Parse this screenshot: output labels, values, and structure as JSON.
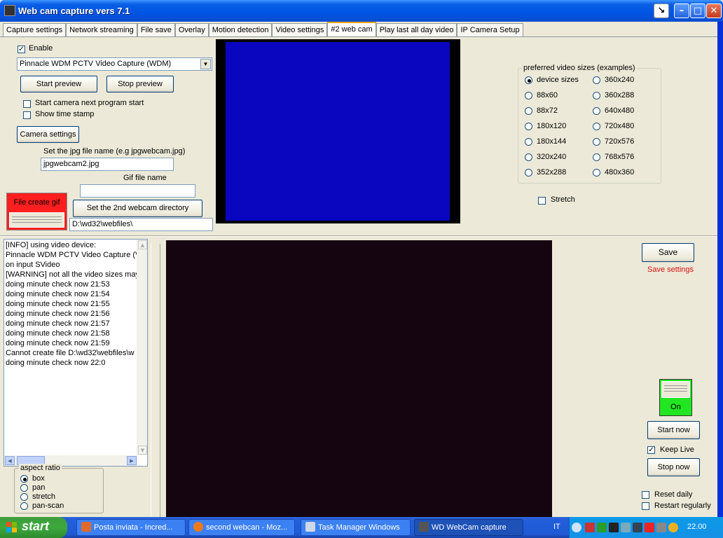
{
  "window": {
    "title": "Web cam capture vers 7.1"
  },
  "tabs": [
    "Capture settings",
    "Network streaming",
    "File save",
    "Overlay",
    "Motion detection",
    "Video settings",
    "#2 web cam",
    "Play last all day video",
    "IP Camera Setup"
  ],
  "active_tab": "#2 web cam",
  "left": {
    "enable_label": "Enable",
    "enable_checked": true,
    "device_select": "Pinnacle WDM PCTV Video Capture (WDM)",
    "start_preview": "Start preview",
    "stop_preview": "Stop preview",
    "start_next_label": "Start camera next program start",
    "show_timestamp_label": "Show time stamp",
    "camera_settings": "Camera settings",
    "jpg_label": "Set the jpg file name (e.g jpgwebcam.jpg)",
    "jpg_value": "jpgwebcam2.jpg",
    "gif_label": "Gif file name",
    "gif_value": "",
    "file_create_gif": "File create gif",
    "set_dir_button": "Set the 2nd webcam directory",
    "dir_value": "D:\\wd32\\webfiles\\"
  },
  "sizes": {
    "title": "preferred video sizes (examples)",
    "col1": [
      "device sizes",
      "88x60",
      "88x72",
      "180x120",
      "180x144",
      "320x240",
      "352x288"
    ],
    "col2": [
      "360x240",
      "360x288",
      "640x480",
      "720x480",
      "720x576",
      "768x576",
      "480x360"
    ],
    "selected": "device sizes",
    "stretch_label": "Stretch"
  },
  "log": [
    "[INFO] using video device:",
    "Pinnacle WDM PCTV Video Capture (V",
    "on input SVideo",
    "[WARNING] not all the video sizes may",
    "doing minute check now 21:53",
    "doing minute check now 21:54",
    "doing minute check now 21:55",
    "doing minute check now 21:56",
    "doing minute check now 21:57",
    "doing minute check now 21:58",
    "doing minute check now 21:59",
    "Cannot create file D:\\wd32\\webfiles\\w",
    "doing minute check now 22:0"
  ],
  "aspect": {
    "title": "aspect ratio",
    "options": [
      "box",
      "pan",
      "stretch",
      "pan-scan"
    ],
    "selected": "box"
  },
  "right": {
    "save": "Save",
    "save_settings": "Save settings",
    "on_label": "On",
    "start_now": "Start now",
    "keep_live": "Keep Live",
    "keep_live_checked": true,
    "stop_now": "Stop now",
    "reset_daily": "Reset daily",
    "restart_regularly": "Restart regularly"
  },
  "colors": {
    "preview_blue": "#0a06c0",
    "video_dark": "#150510",
    "gif_red": "#ff1f1f",
    "on_green": "#22e622",
    "save_settings_red": "#d81010"
  },
  "taskbar": {
    "start": "start",
    "tasks": [
      "Posta inviata - Incred...",
      "second webcan - Moz...",
      "Task Manager Windows",
      "WD WebCam capture"
    ],
    "lang": "IT",
    "clock": "22.00"
  }
}
